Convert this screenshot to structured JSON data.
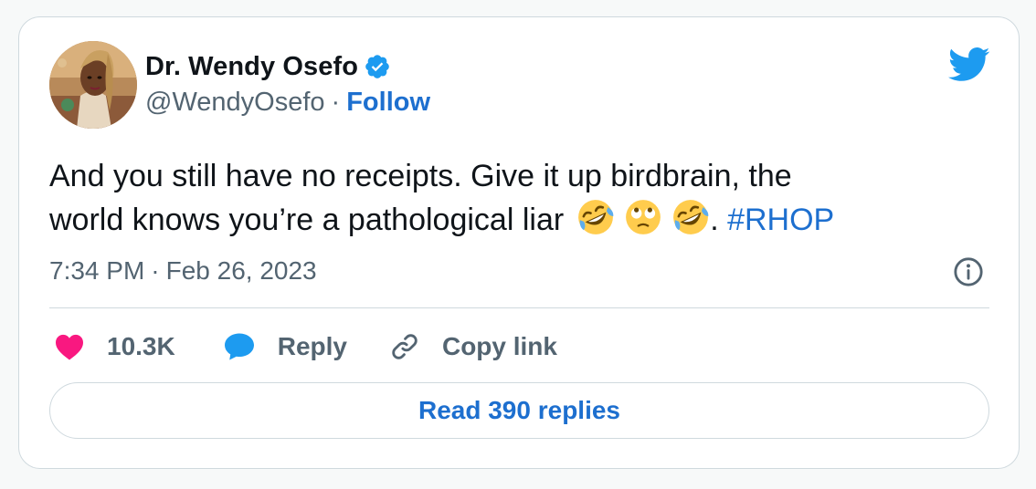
{
  "author": {
    "display_name": "Dr. Wendy Osefo",
    "handle": "@WendyOsefo",
    "separator": "·",
    "follow_label": "Follow",
    "verified": true
  },
  "tweet": {
    "line1": "And you still have no receipts. Give it up birdbrain, the",
    "line2_text": "world knows you’re a pathological liar",
    "emojis": [
      "rolling-on-floor-laughing-emoji",
      "face-with-rolling-eyes-emoji",
      "rolling-on-floor-laughing-emoji"
    ],
    "period": ".",
    "hashtag": "#RHOP"
  },
  "meta": {
    "time": "7:34 PM",
    "separator": "·",
    "date": "Feb 26, 2023"
  },
  "actions": {
    "likes": "10.3K",
    "reply_label": "Reply",
    "copy_link_label": "Copy link"
  },
  "read_replies_label": "Read 390 replies",
  "colors": {
    "link_blue": "#1d6fcf",
    "twitter_blue": "#1d9bf0",
    "like_pink": "#f91880",
    "muted_text": "#536471",
    "border": "#cfd9de"
  },
  "icons": {
    "brand": "twitter-bird-icon",
    "verified": "verified-badge-icon",
    "info": "info-icon",
    "like": "heart-icon",
    "reply": "reply-bubble-icon",
    "copy_link": "link-icon"
  }
}
